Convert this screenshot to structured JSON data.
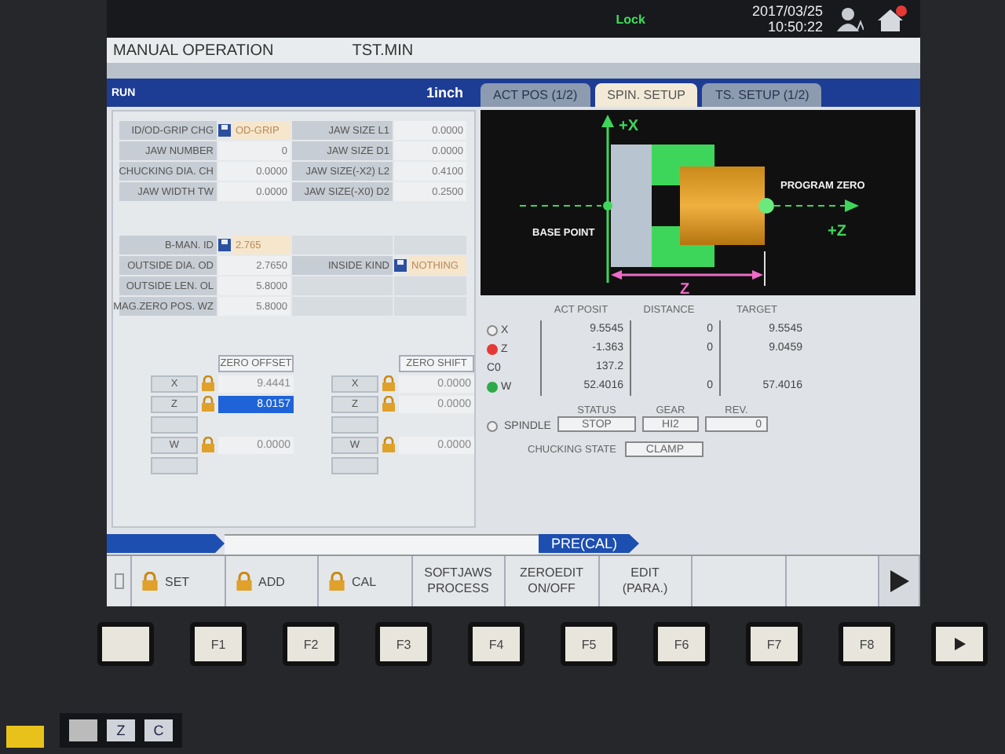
{
  "status": {
    "lock": "Lock",
    "date": "2017/03/25",
    "time": "10:50:22"
  },
  "header": {
    "mode": "MANUAL OPERATION",
    "program": "TST.MIN"
  },
  "run_bar": {
    "status": "RUN",
    "unit": "1inch"
  },
  "tabs": [
    {
      "label": "ACT POS (1/2)",
      "selected": false
    },
    {
      "label": "SPIN. SETUP",
      "selected": true
    },
    {
      "label": "TS. SETUP (1/2)",
      "selected": false
    }
  ],
  "chuck_table": [
    [
      {
        "kind": "label",
        "text": "ID/OD-GRIP CHG"
      },
      {
        "kind": "select",
        "text": "OD-GRIP"
      },
      {
        "kind": "label",
        "text": "JAW SIZE L1"
      },
      {
        "kind": "value",
        "text": "0.0000"
      }
    ],
    [
      {
        "kind": "label",
        "text": "JAW NUMBER"
      },
      {
        "kind": "value",
        "text": "0"
      },
      {
        "kind": "label",
        "text": "JAW SIZE D1"
      },
      {
        "kind": "value",
        "text": "0.0000"
      }
    ],
    [
      {
        "kind": "label",
        "text": "CHUCKING DIA. CH"
      },
      {
        "kind": "value",
        "text": "0.0000"
      },
      {
        "kind": "label",
        "text": "JAW SIZE(-X2) L2"
      },
      {
        "kind": "value",
        "text": "0.4100"
      }
    ],
    [
      {
        "kind": "label",
        "text": "JAW WIDTH TW"
      },
      {
        "kind": "value",
        "text": "0.0000"
      },
      {
        "kind": "label",
        "text": "JAW SIZE(-X0) D2"
      },
      {
        "kind": "value",
        "text": "0.2500"
      }
    ]
  ],
  "work_table": [
    [
      {
        "kind": "label",
        "text": "B-MAN. ID"
      },
      {
        "kind": "select",
        "text": "2.765"
      },
      {
        "kind": "blank"
      },
      {
        "kind": "blank"
      }
    ],
    [
      {
        "kind": "label",
        "text": "OUTSIDE DIA. OD"
      },
      {
        "kind": "value",
        "text": "2.7650"
      },
      {
        "kind": "label",
        "text": "INSIDE KIND"
      },
      {
        "kind": "select",
        "text": "NOTHING"
      }
    ],
    [
      {
        "kind": "label",
        "text": "OUTSIDE LEN. OL"
      },
      {
        "kind": "value",
        "text": "5.8000"
      },
      {
        "kind": "blank"
      },
      {
        "kind": "blank"
      }
    ],
    [
      {
        "kind": "label",
        "text": "MAG.ZERO POS. WZ"
      },
      {
        "kind": "value",
        "text": "5.8000"
      },
      {
        "kind": "blank"
      },
      {
        "kind": "blank"
      }
    ]
  ],
  "zero_offset": {
    "title": "ZERO OFFSET",
    "rows": [
      {
        "axis": "X",
        "locked": true,
        "value": "9.4441",
        "selected": false
      },
      {
        "axis": "Z",
        "locked": true,
        "value": "8.0157",
        "selected": true
      },
      {
        "locked": false,
        "selected": false
      },
      {
        "axis": "W",
        "locked": true,
        "value": "0.0000",
        "selected": false
      },
      {
        "locked": false,
        "selected": false
      }
    ]
  },
  "zero_shift": {
    "title": "ZERO SHIFT",
    "rows": [
      {
        "axis": "X",
        "locked": true,
        "value": "0.0000"
      },
      {
        "axis": "Z",
        "locked": true,
        "value": "0.0000"
      },
      {
        "locked": false
      },
      {
        "axis": "W",
        "locked": true,
        "value": "0.0000"
      },
      {
        "locked": false
      }
    ]
  },
  "diagram": {
    "x_axis": "+X",
    "z_axis": "+Z",
    "base_point": "BASE POINT",
    "program_zero": "PROGRAM ZERO",
    "dimension": "Z"
  },
  "position": {
    "columns": [
      "ACT POSIT",
      "DISTANCE",
      "TARGET"
    ],
    "rows": [
      {
        "axis": "X",
        "lamp": true,
        "act": "9.5545",
        "distance": "0",
        "target": "9.5545"
      },
      {
        "axis": "Z",
        "lamp": true,
        "color": "#e53935",
        "act": "-1.363",
        "distance": "0",
        "target": "9.0459"
      },
      {
        "axis": "C0",
        "lamp": false,
        "act": "137.2"
      },
      {
        "axis": "W",
        "lamp": true,
        "color": "#2eaa4a",
        "act": "52.4016",
        "distance": "0",
        "target": "57.4016"
      }
    ]
  },
  "spindle": {
    "label": "SPINDLE",
    "status_label": "STATUS",
    "status": "STOP",
    "gear_label": "GEAR",
    "gear": "HI2",
    "rev_label": "REV.",
    "rev": "0"
  },
  "chucking": {
    "label": "CHUCKING STATE",
    "value": "CLAMP"
  },
  "softkeys": {
    "mode": "PRE(CAL)",
    "keys": [
      {
        "kind": "icon"
      },
      {
        "kind": "lock",
        "label": "SET"
      },
      {
        "kind": "lock",
        "label": "ADD"
      },
      {
        "kind": "lock",
        "label": "CAL"
      },
      {
        "kind": "text",
        "label": "SOFTJAWS\nPROCESS"
      },
      {
        "kind": "text",
        "label": "ZEROEDIT\nON/OFF"
      },
      {
        "kind": "text",
        "label": "EDIT\n(PARA.)"
      },
      {
        "kind": "blank"
      },
      {
        "kind": "blank"
      },
      {
        "kind": "arrow"
      }
    ]
  },
  "hardware_keys": [
    {
      "kind": "blank"
    },
    {
      "kind": "label",
      "label": "F1"
    },
    {
      "kind": "label",
      "label": "F2"
    },
    {
      "kind": "label",
      "label": "F3"
    },
    {
      "kind": "label",
      "label": "F4"
    },
    {
      "kind": "label",
      "label": "F5"
    },
    {
      "kind": "label",
      "label": "F6"
    },
    {
      "kind": "label",
      "label": "F7"
    },
    {
      "kind": "label",
      "label": "F8"
    },
    {
      "kind": "arrow"
    }
  ],
  "lower_keys": [
    "Z",
    "C"
  ]
}
